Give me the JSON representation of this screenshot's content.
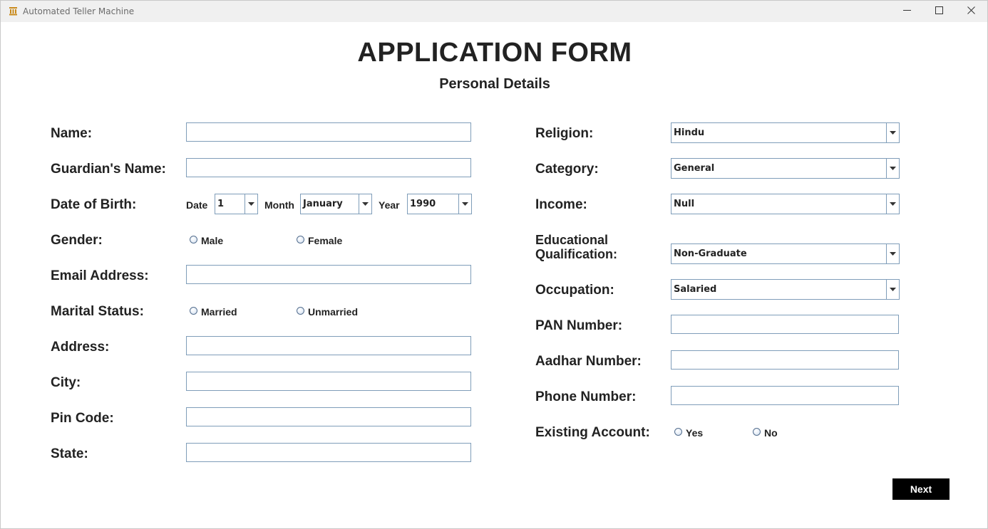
{
  "window": {
    "title": "Automated Teller Machine"
  },
  "header": {
    "title": "APPLICATION FORM",
    "subtitle": "Personal Details"
  },
  "left": {
    "name_label": "Name:",
    "guardian_label": "Guardian's Name:",
    "dob_label": "Date of Birth:",
    "date_label": "Date",
    "date_value": "1",
    "month_label": "Month",
    "month_value": "January",
    "year_label": "Year",
    "year_value": "1990",
    "gender_label": "Gender:",
    "male": "Male",
    "female": "Female",
    "email_label": "Email Address:",
    "marital_label": "Marital Status:",
    "married": "Married",
    "unmarried": "Unmarried",
    "address_label": "Address:",
    "city_label": "City:",
    "pin_label": "Pin Code:",
    "state_label": "State:"
  },
  "right": {
    "religion_label": "Religion:",
    "religion_value": "Hindu",
    "category_label": "Category:",
    "category_value": "General",
    "income_label": "Income:",
    "income_value": "Null",
    "education_label_1": "Educational",
    "education_label_2": "Qualification:",
    "education_value": "Non-Graduate",
    "occupation_label": "Occupation:",
    "occupation_value": "Salaried",
    "pan_label": "PAN Number:",
    "aadhar_label": "Aadhar Number:",
    "phone_label": "Phone Number:",
    "existing_label": "Existing Account:",
    "yes": "Yes",
    "no": "No"
  },
  "actions": {
    "next": "Next"
  },
  "colors": {
    "field_border": "#7f9db9",
    "button_bg": "#000000",
    "button_text": "#ffffff"
  }
}
